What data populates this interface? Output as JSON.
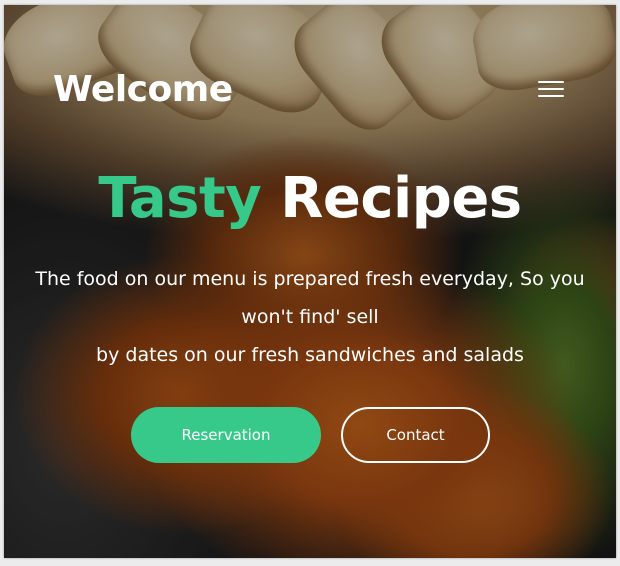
{
  "header": {
    "brand": "Welcome",
    "menu_icon": "hamburger-menu-icon"
  },
  "hero": {
    "title_accent": "Tasty",
    "title_rest": "Recipes",
    "description_lines": [
      "The food on our menu is prepared fresh everyday, So you won't find' sell",
      "by dates on our fresh sandwiches and salads"
    ],
    "reservation_label": "Reservation",
    "contact_label": "Contact"
  },
  "colors": {
    "accent": "#36c98a",
    "text": "#ffffff"
  }
}
